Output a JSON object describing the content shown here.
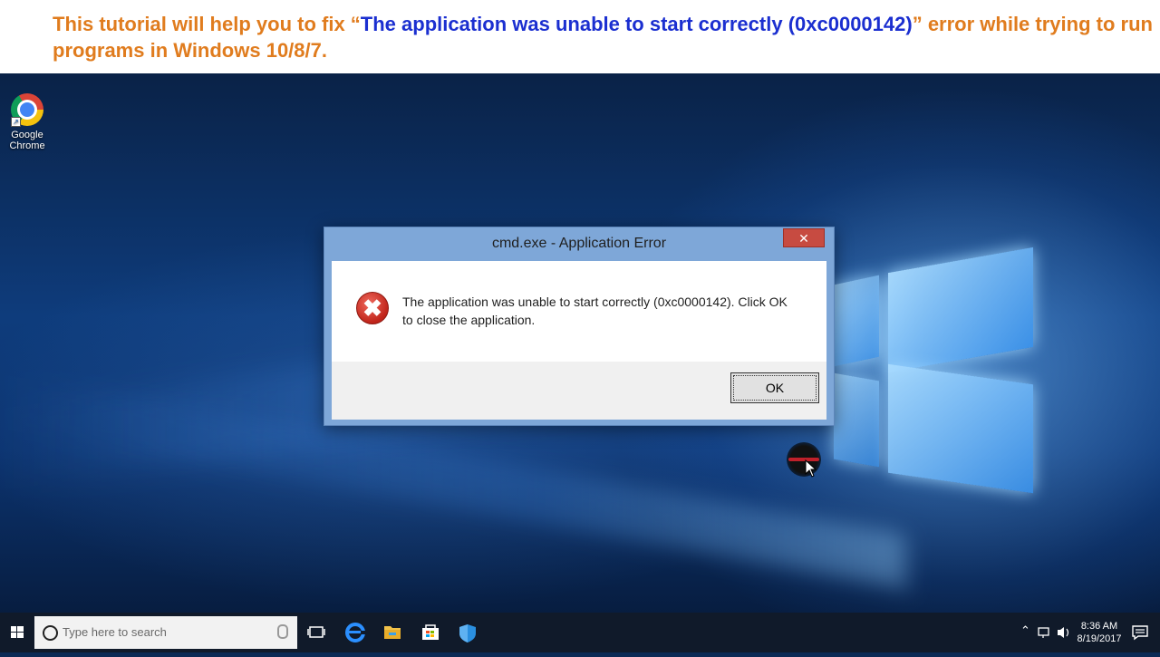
{
  "banner": {
    "prefix": "This tutorial will help you to fix “",
    "highlight": "The application was unable to start correctly (0xc0000142)",
    "suffix": "” error while trying to run programs in Windows 10/8/7."
  },
  "desktop": {
    "icons": [
      {
        "label_line1": "Google",
        "label_line2": "Chrome",
        "icon": "chrome-icon"
      }
    ]
  },
  "dialog": {
    "title": "cmd.exe - Application Error",
    "close_glyph": "✕",
    "message": "The application was unable to start correctly (0xc0000142). Click OK to close the application.",
    "error_glyph": "✖",
    "ok_label": "OK"
  },
  "taskbar": {
    "search_placeholder": "Type here to search",
    "apps": [
      "task-view-icon",
      "edge-icon",
      "file-explorer-icon",
      "store-icon",
      "defender-icon"
    ],
    "time": "8:36 AM",
    "date": "8/19/2017"
  },
  "colors": {
    "banner_orange": "#e07c1e",
    "banner_blue": "#1b2fd0",
    "dialog_frame": "#7ea7d8",
    "close_red": "#c74b41",
    "taskbar": "#101a2a"
  }
}
